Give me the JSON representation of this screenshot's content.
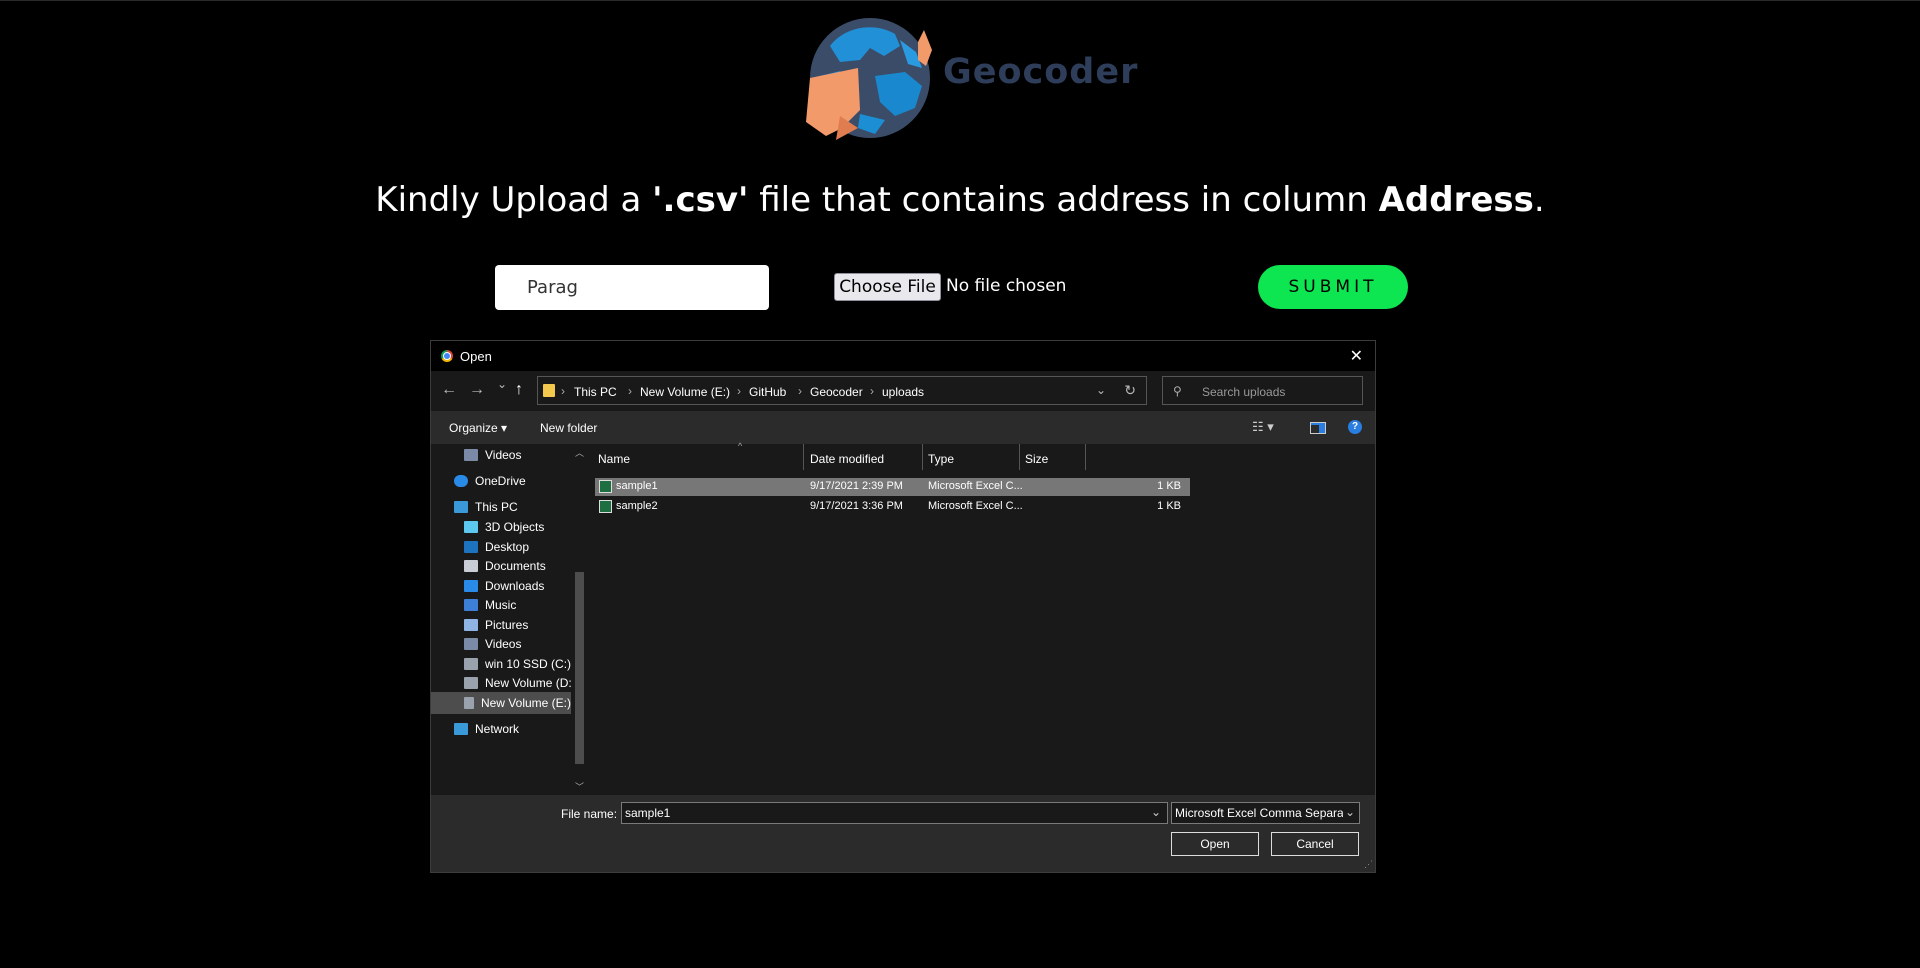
{
  "app": {
    "brand": "Geocoder",
    "headline_prefix": "Kindly Upload a ",
    "headline_ext": "'.csv'",
    "headline_mid": " file that contains address in column ",
    "headline_col": "Address",
    "headline_end": ".",
    "name_input_value": "Parag",
    "choose_file_label": "Choose File",
    "file_status": "No file chosen",
    "submit_label": "SUBMIT",
    "colors": {
      "submit": "#0de651",
      "brand": "#2e3e5a"
    }
  },
  "dialog": {
    "title": "Open",
    "close": "✕",
    "nav": {
      "back": "←",
      "forward": "→",
      "recent": "⌄",
      "up": "↑"
    },
    "breadcrumbs": [
      "This PC",
      "New Volume (E:)",
      "GitHub",
      "Geocoder",
      "uploads"
    ],
    "search_placeholder": "Search uploads",
    "toolbar": {
      "organize": "Organize",
      "new_folder": "New folder"
    },
    "sidebar": [
      {
        "label": "Videos",
        "icon": "videos-icon"
      },
      {
        "label": "OneDrive",
        "icon": "cloud-icon"
      },
      {
        "label": "This PC",
        "icon": "computer-icon"
      },
      {
        "label": "3D Objects",
        "icon": "cube-icon"
      },
      {
        "label": "Desktop",
        "icon": "desktop-icon"
      },
      {
        "label": "Documents",
        "icon": "document-icon"
      },
      {
        "label": "Downloads",
        "icon": "download-icon"
      },
      {
        "label": "Music",
        "icon": "music-icon"
      },
      {
        "label": "Pictures",
        "icon": "pictures-icon"
      },
      {
        "label": "Videos",
        "icon": "videos-icon"
      },
      {
        "label": "win 10 SSD (C:)",
        "icon": "drive-icon"
      },
      {
        "label": "New Volume (D:",
        "icon": "drive-icon"
      },
      {
        "label": "New Volume (E:)",
        "icon": "drive-icon"
      },
      {
        "label": "Network",
        "icon": "network-icon"
      }
    ],
    "columns": [
      "Name",
      "Date modified",
      "Type",
      "Size"
    ],
    "files": [
      {
        "name": "sample1",
        "date": "9/17/2021 2:39 PM",
        "type": "Microsoft Excel C...",
        "size": "1 KB"
      },
      {
        "name": "sample2",
        "date": "9/17/2021 3:36 PM",
        "type": "Microsoft Excel C...",
        "size": "1 KB"
      }
    ],
    "file_name_label": "File name:",
    "file_name_value": "sample1",
    "file_type_value": "Microsoft Excel Comma Separa",
    "open_label": "Open",
    "cancel_label": "Cancel"
  }
}
